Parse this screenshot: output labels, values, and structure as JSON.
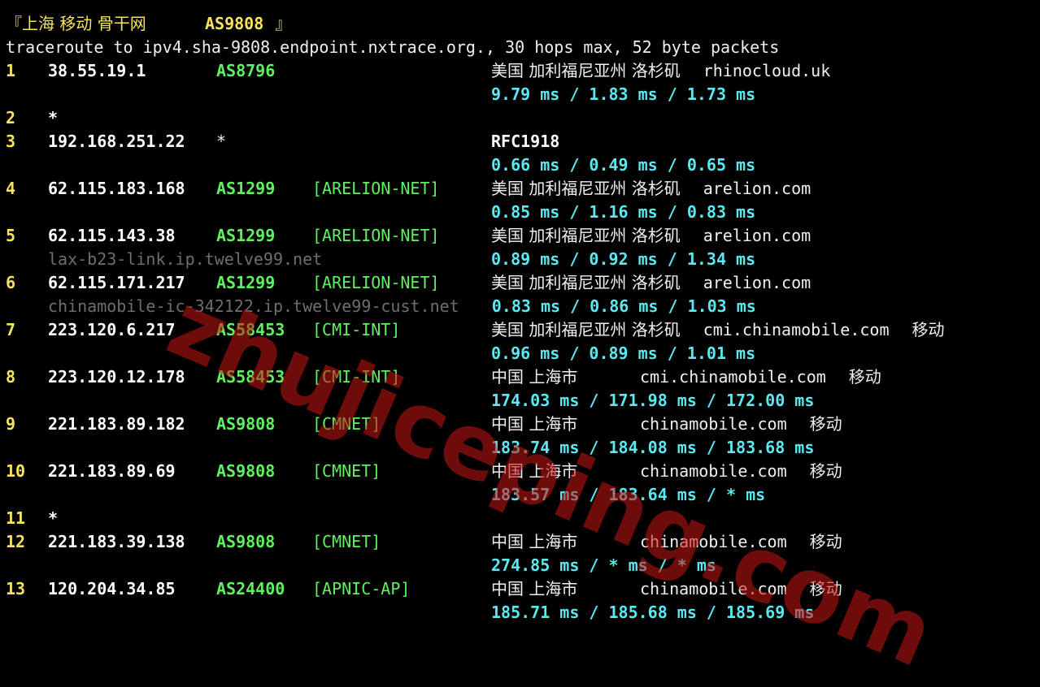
{
  "header": {
    "title_open": "『上海 移动 骨干网 ",
    "title_as": "AS9808",
    "title_close": " 』",
    "command": "traceroute to ipv4.sha-9808.endpoint.nxtrace.org., 30 hops max, 52 byte packets"
  },
  "hops": [
    {
      "hop": "1",
      "ip": "38.55.19.1",
      "asn": "AS8796",
      "tag": "",
      "geo": "美国 加利福尼亚州 洛杉矶",
      "domain": "rhinocloud.uk",
      "isp": "",
      "rdns": "",
      "rtt": "9.79 ms / 1.83 ms / 1.73 ms"
    },
    {
      "hop": "2",
      "ip": "*"
    },
    {
      "hop": "3",
      "ip": "192.168.251.22",
      "asn": "*",
      "tag": "",
      "geo": "RFC1918",
      "domain": "",
      "isp": "",
      "rdns": "",
      "rtt": "0.66 ms / 0.49 ms / 0.65 ms"
    },
    {
      "hop": "4",
      "ip": "62.115.183.168",
      "asn": "AS1299",
      "tag": "[ARELION-NET]",
      "geo": "美国 加利福尼亚州 洛杉矶",
      "domain": "arelion.com",
      "isp": "",
      "rdns": "",
      "rtt": "0.85 ms / 1.16 ms / 0.83 ms"
    },
    {
      "hop": "5",
      "ip": "62.115.143.38",
      "asn": "AS1299",
      "tag": "[ARELION-NET]",
      "geo": "美国 加利福尼亚州 洛杉矶",
      "domain": "arelion.com",
      "isp": "",
      "rdns": "lax-b23-link.ip.twelve99.net",
      "rtt": "0.89 ms / 0.92 ms / 1.34 ms"
    },
    {
      "hop": "6",
      "ip": "62.115.171.217",
      "asn": "AS1299",
      "tag": "[ARELION-NET]",
      "geo": "美国 加利福尼亚州 洛杉矶",
      "domain": "arelion.com",
      "isp": "",
      "rdns": "chinamobile-ic-342122.ip.twelve99-cust.net",
      "rtt": "0.83 ms / 0.86 ms / 1.03 ms"
    },
    {
      "hop": "7",
      "ip": "223.120.6.217",
      "asn": "AS58453",
      "tag": "[CMI-INT]",
      "geo": "美国 加利福尼亚州 洛杉矶",
      "domain": "cmi.chinamobile.com",
      "isp": "移动",
      "rdns": "",
      "rtt": "0.96 ms / 0.89 ms / 1.01 ms"
    },
    {
      "hop": "8",
      "ip": "223.120.12.178",
      "asn": "AS58453",
      "tag": "[CMI-INT]",
      "geo": "中国 上海市",
      "domain": "cmi.chinamobile.com",
      "isp": "移动",
      "rdns": "",
      "rtt": "174.03 ms / 171.98 ms / 172.00 ms"
    },
    {
      "hop": "9",
      "ip": "221.183.89.182",
      "asn": "AS9808",
      "tag": "[CMNET]",
      "geo": "中国 上海市",
      "domain": "chinamobile.com",
      "isp": "移动",
      "rdns": "",
      "rtt": "183.74 ms / 184.08 ms / 183.68 ms"
    },
    {
      "hop": "10",
      "ip": "221.183.89.69",
      "asn": "AS9808",
      "tag": "[CMNET]",
      "geo": "中国 上海市",
      "domain": "chinamobile.com",
      "isp": "移动",
      "rdns": "",
      "rtt": "183.57 ms / 183.64 ms / * ms"
    },
    {
      "hop": "11",
      "ip": "*"
    },
    {
      "hop": "12",
      "ip": "221.183.39.138",
      "asn": "AS9808",
      "tag": "[CMNET]",
      "geo": "中国 上海市",
      "domain": "chinamobile.com",
      "isp": "移动",
      "rdns": "",
      "rtt": "274.85 ms / * ms / * ms"
    },
    {
      "hop": "13",
      "ip": "120.204.34.85",
      "asn": "AS24400",
      "tag": "[APNIC-AP]",
      "geo": "中国 上海市",
      "domain": "chinamobile.com",
      "isp": "移动",
      "rdns": "",
      "rtt": "185.71 ms / 185.68 ms / 185.69 ms"
    }
  ],
  "watermark": "zhujiceping.com",
  "colors": {
    "background": "#000000",
    "hop_number": "#f8e45c",
    "ip": "#ffffff",
    "asn": "#5ff05f",
    "rtt": "#5ce8f0",
    "rdns": "#6e6e6e",
    "watermark": "#c81414"
  }
}
